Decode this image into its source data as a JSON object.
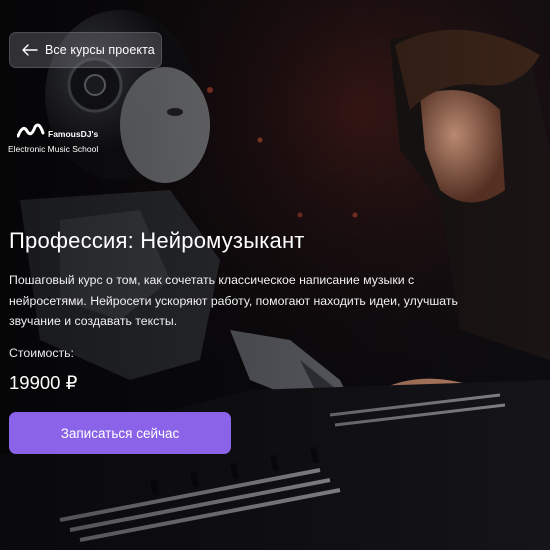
{
  "nav": {
    "back_label": "Все курсы проекта",
    "back_icon": "arrow-left-icon"
  },
  "logo": {
    "brand": "FamousDJ's",
    "tagline": "Electronic Music School"
  },
  "course": {
    "title": "Профессия: Нейромузыкант",
    "description": "Пошаговый курс о том, как сочетать классическое написание музыки с нейросетями. Нейросети ускоряют работу, помогают находить идеи, улучшать звучание и создавать тексты.",
    "price_label": "Стоимость:",
    "price": "19900 ₽",
    "enroll_label": "Записаться сейчас"
  },
  "colors": {
    "accent": "#8b63e8",
    "background": "#0b0a0d"
  }
}
